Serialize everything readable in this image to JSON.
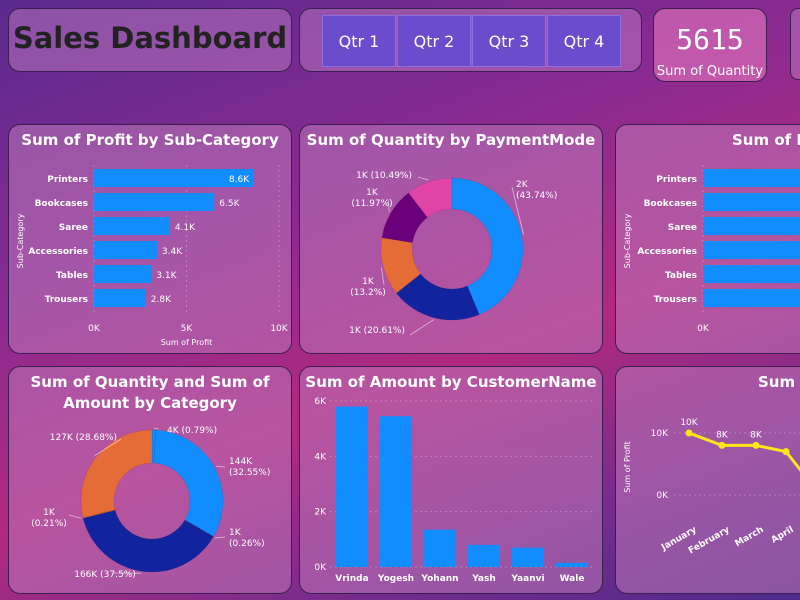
{
  "header": {
    "title": "Sales Dashboard",
    "quarters": [
      "Qtr 1",
      "Qtr 2",
      "Qtr 3",
      "Qtr 4"
    ],
    "kpi_value": "5615",
    "kpi_label": "Sum of Quantity"
  },
  "colors": {
    "bar": "#118dff",
    "line": "#ffe81a"
  },
  "chart_data": [
    {
      "id": "profit_by_subcategory",
      "type": "bar",
      "orientation": "horizontal",
      "title": "Sum of Profit by Sub-Category",
      "xlabel": "Sum of Profit",
      "ylabel": "Sub-Category",
      "categories": [
        "Printers",
        "Bookcases",
        "Saree",
        "Accessories",
        "Tables",
        "Trousers"
      ],
      "values": [
        8600,
        6500,
        4100,
        3400,
        3100,
        2800
      ],
      "data_labels": [
        "8.6K",
        "6.5K",
        "4.1K",
        "3.4K",
        "3.1K",
        "2.8K"
      ],
      "xlim": [
        0,
        10000
      ],
      "xticks": [
        0,
        5000,
        10000
      ],
      "xtick_labels": [
        "0K",
        "5K",
        "10K"
      ]
    },
    {
      "id": "quantity_by_paymentmode",
      "type": "pie",
      "donut": true,
      "title": "Sum of Quantity by PaymentMode",
      "slices": [
        {
          "value": 43.74,
          "label": "2K\n(43.74%)",
          "color": "#118dff"
        },
        {
          "value": 20.61,
          "label": "1K (20.61%)",
          "color": "#12239e"
        },
        {
          "value": 13.2,
          "label": "1K\n(13.2%)",
          "color": "#e66c37"
        },
        {
          "value": 11.97,
          "label": "1K\n(11.97%)",
          "color": "#6b007b"
        },
        {
          "value": 10.49,
          "label": "1K (10.49%)",
          "color": "#e044a7"
        }
      ]
    },
    {
      "id": "quantity_amount_by_category",
      "type": "pie",
      "donut": true,
      "title": "Sum of Quantity and Sum of Amount by Category",
      "title_lines": [
        "Sum of Quantity and Sum of",
        "Amount by Category"
      ],
      "slices": [
        {
          "value": 0.79,
          "label": "4K (0.79%)",
          "color": "#118dff"
        },
        {
          "value": 32.55,
          "label": "144K\n(32.55%)",
          "color": "#118dff"
        },
        {
          "value": 0.26,
          "label": "1K\n(0.26%)",
          "color": "#12239e"
        },
        {
          "value": 37.5,
          "label": "166K (37.5%)",
          "color": "#12239e"
        },
        {
          "value": 0.21,
          "label": "1K\n(0.21%)",
          "color": "#e66c37"
        },
        {
          "value": 28.68,
          "label": "127K (28.68%)",
          "color": "#e66c37"
        }
      ]
    },
    {
      "id": "amount_by_customername",
      "type": "bar",
      "orientation": "vertical",
      "title": "Sum of Amount by CustomerName",
      "categories": [
        "Vrinda",
        "Yogesh",
        "Yohann",
        "Yash",
        "Yaanvi",
        "Wale"
      ],
      "values": [
        5800,
        5450,
        1350,
        800,
        700,
        150
      ],
      "ylim": [
        0,
        6000
      ],
      "yticks": [
        0,
        2000,
        4000,
        6000
      ],
      "ytick_labels": [
        "0K",
        "2K",
        "4K",
        "6K"
      ]
    },
    {
      "id": "profit_by_month",
      "type": "line",
      "title": "Sum c",
      "ylabel": "Sum of Profit",
      "categories": [
        "January",
        "February",
        "March",
        "April"
      ],
      "values": [
        10000,
        8000,
        8000,
        7000
      ],
      "data_labels": [
        "10K",
        "8K",
        "8K",
        ""
      ],
      "yticks": [
        0,
        10000
      ],
      "ytick_labels": [
        "0K",
        "10K"
      ]
    },
    {
      "id": "profit_partial",
      "type": "bar",
      "orientation": "horizontal",
      "title": "Sum of Pr",
      "ylabel": "Sub-Category",
      "categories": [
        "Printers",
        "Bookcases",
        "Saree",
        "Accessories",
        "Tables",
        "Trousers"
      ],
      "xtick_labels": [
        "0K"
      ]
    }
  ]
}
